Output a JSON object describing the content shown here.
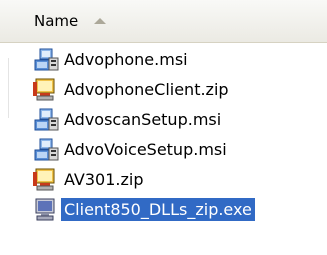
{
  "header": {
    "name_column": "Name",
    "sort_icon": "sort-ascending-icon"
  },
  "files": [
    {
      "name": "Advophone.msi",
      "icon": "msi-installer-icon",
      "selected": false
    },
    {
      "name": "AdvophoneClient.zip",
      "icon": "winzip-archive-icon",
      "selected": false
    },
    {
      "name": "AdvoscanSetup.msi",
      "icon": "msi-installer-icon",
      "selected": false
    },
    {
      "name": "AdvoVoiceSetup.msi",
      "icon": "msi-installer-icon",
      "selected": false
    },
    {
      "name": "AV301.zip",
      "icon": "winzip-archive-icon",
      "selected": false
    },
    {
      "name": "Client850_DLLs_zip.exe",
      "icon": "exe-application-icon",
      "selected": true
    }
  ],
  "colors": {
    "selection": "#316ac5",
    "selection_text": "#ffffff"
  }
}
